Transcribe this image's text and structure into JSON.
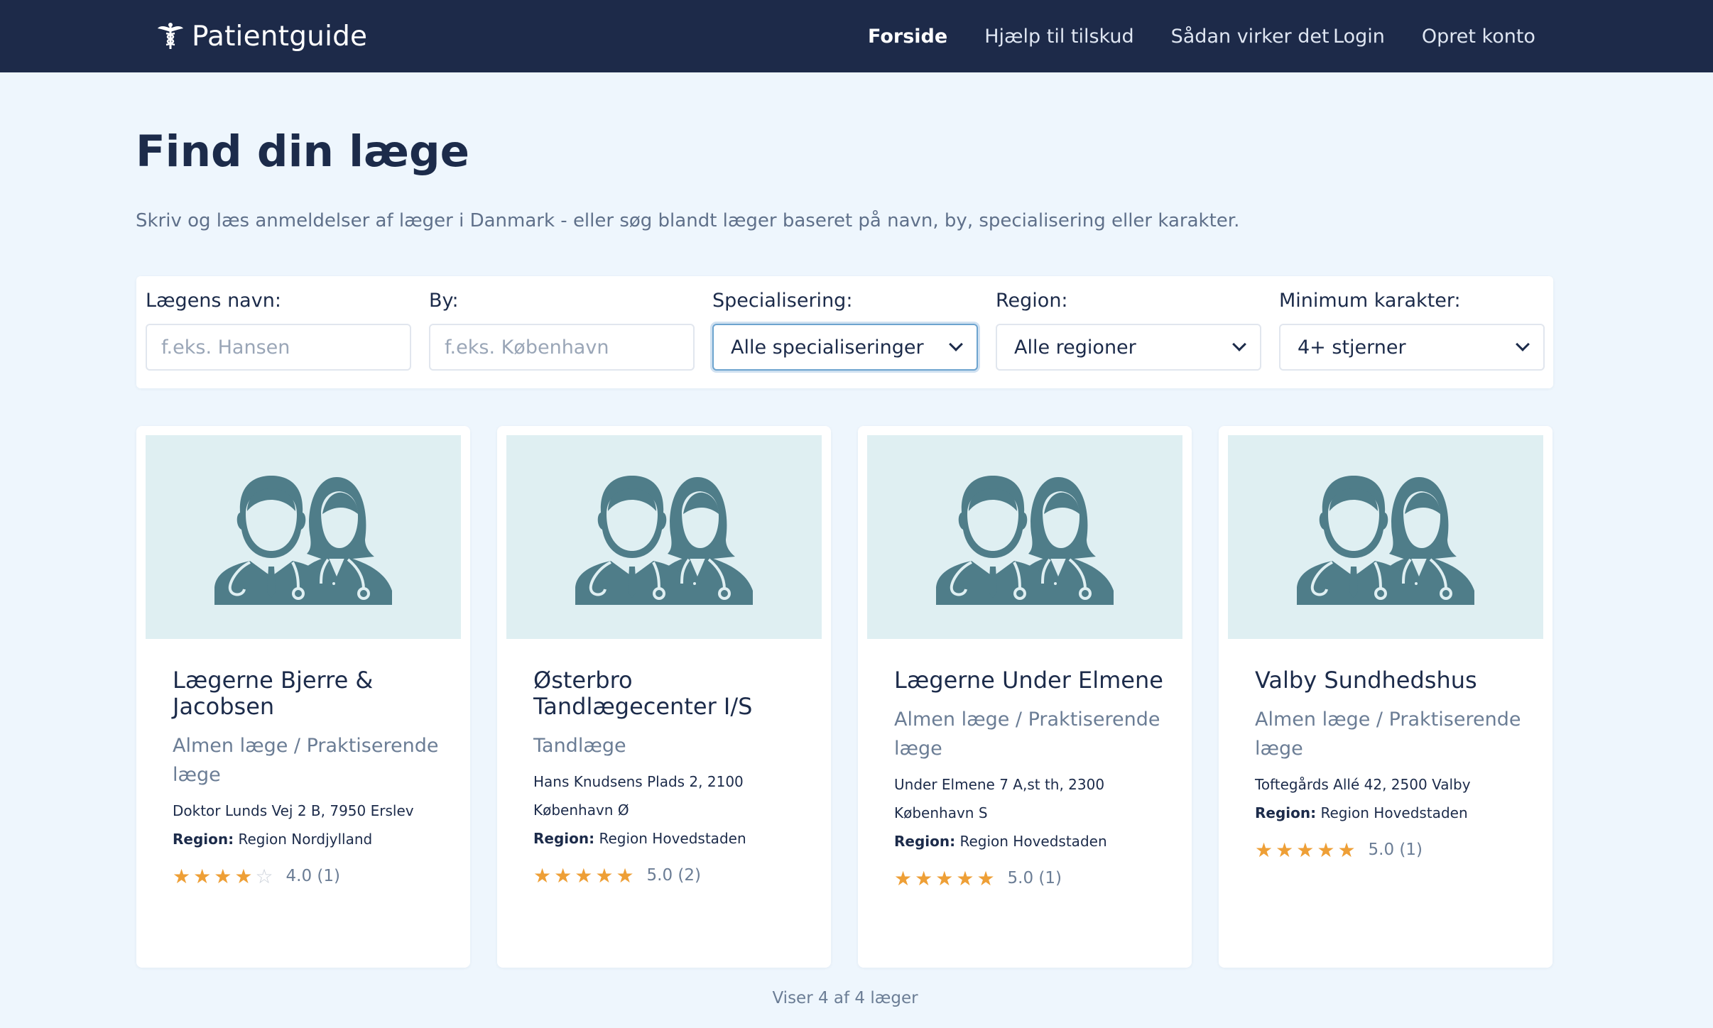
{
  "nav": {
    "brand": "Patientguide",
    "links": [
      "Forside",
      "Hjælp til tilskud",
      "Sådan virker det"
    ],
    "login": "Login",
    "signup": "Opret konto"
  },
  "header": {
    "title": "Find din læge",
    "subtitle": "Skriv og læs anmeldelser af læger i Danmark - eller søg blandt læger baseret på navn, by, specialisering eller karakter."
  },
  "filters": {
    "name": {
      "label": "Lægens navn:",
      "placeholder": "f.eks. Hansen"
    },
    "city": {
      "label": "By:",
      "placeholder": "f.eks. København"
    },
    "specialization": {
      "label": "Specialisering:",
      "value": "Alle specialiseringer"
    },
    "region": {
      "label": "Region:",
      "value": "Alle regioner"
    },
    "min_rating": {
      "label": "Minimum karakter:",
      "value": "4+ stjerner"
    }
  },
  "region_label": "Region:",
  "cards": [
    {
      "name": "Lægerne Bjerre & Jacobsen",
      "specialty": "Almen læge / Praktiserende læge",
      "address": "Doktor Lunds Vej 2 B, 7950 Erslev",
      "region": "Region Nordjylland",
      "rating": 4,
      "rating_text": "4.0 (1)"
    },
    {
      "name": "Østerbro Tandlægecenter I/S",
      "specialty": "Tandlæge",
      "address": "Hans Knudsens Plads 2, 2100 København Ø",
      "region": "Region Hovedstaden",
      "rating": 5,
      "rating_text": "5.0 (2)"
    },
    {
      "name": "Lægerne Under Elmene",
      "specialty": "Almen læge / Praktiserende læge",
      "address": "Under Elmene 7 A,st th, 2300 København S",
      "region": "Region Hovedstaden",
      "rating": 5,
      "rating_text": "5.0 (1)"
    },
    {
      "name": "Valby Sundhedshus",
      "specialty": "Almen læge / Praktiserende læge",
      "address": "Toftegårds Allé 42, 2500 Valby",
      "region": "Region Hovedstaden",
      "rating": 5,
      "rating_text": "5.0 (1)"
    }
  ],
  "results_count": "Viser 4 af 4 læger",
  "colors": {
    "navbar": "#1d2a49",
    "background": "#eef6fd",
    "star": "#ee9f36",
    "illustration": "#4f7d89",
    "image_bg": "#dfeff2"
  }
}
